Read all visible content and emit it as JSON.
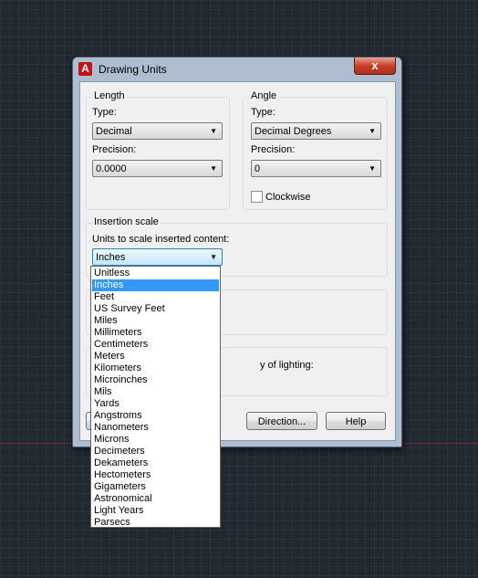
{
  "dialog": {
    "title": "Drawing Units",
    "close_label": "x",
    "app_icon": "A"
  },
  "length": {
    "group_label": "Length",
    "type_label": "Type:",
    "type_value": "Decimal",
    "precision_label": "Precision:",
    "precision_value": "0.0000"
  },
  "angle": {
    "group_label": "Angle",
    "type_label": "Type:",
    "type_value": "Decimal Degrees",
    "precision_label": "Precision:",
    "precision_value": "0",
    "clockwise_label": "Clockwise",
    "clockwise_checked": false
  },
  "insertion": {
    "group_label": "Insertion scale",
    "units_label": "Units to scale inserted content:",
    "units_value": "Inches",
    "options": [
      "Unitless",
      "Inches",
      "Feet",
      "US Survey Feet",
      "Miles",
      "Millimeters",
      "Centimeters",
      "Meters",
      "Kilometers",
      "Microinches",
      "Mils",
      "Yards",
      "Angstroms",
      "Nanometers",
      "Microns",
      "Decimeters",
      "Dekameters",
      "Hectometers",
      "Gigameters",
      "Astronomical",
      "Light Years",
      "Parsecs"
    ],
    "selected_index": 1
  },
  "lighting": {
    "partial_label": "y of lighting:"
  },
  "buttons": {
    "direction": "Direction...",
    "help": "Help"
  },
  "colors": {
    "selection": "#3399ff",
    "title_close": "#c7412a"
  }
}
